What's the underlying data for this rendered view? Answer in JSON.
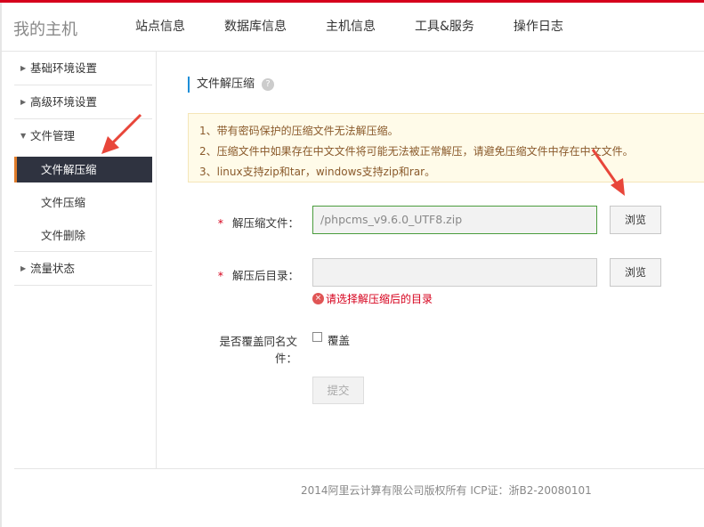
{
  "header": {
    "brand": "我的主机",
    "nav": [
      "站点信息",
      "数据库信息",
      "主机信息",
      "工具&服务",
      "操作日志"
    ]
  },
  "sidebar": {
    "basic_env": "基础环境设置",
    "advanced_env": "高级环境设置",
    "file_mgmt": "文件管理",
    "sub_items": [
      "文件解压缩",
      "文件压缩",
      "文件删除"
    ],
    "traffic": "流量状态"
  },
  "section": {
    "title": "文件解压缩",
    "help": "?"
  },
  "notice": {
    "lines": [
      "1、带有密码保护的压缩文件无法解压缩。",
      "2、压缩文件中如果存在中文文件将可能无法被正常解压，请避免压缩文件中存在中文文件。",
      "3、linux支持zip和tar，windows支持zip和rar。"
    ]
  },
  "form": {
    "required_mark": "*",
    "archive_label": "解压缩文件：",
    "archive_value": "/phpcms_v9.6.0_UTF8.zip",
    "target_label": "解压后目录：",
    "target_value": "",
    "browse": "浏览",
    "error": "请选择解压缩后的目录",
    "error_icon": "×",
    "overwrite_label": "是否覆盖同名文件：",
    "overwrite_option": "覆盖",
    "overwrite_checked": false,
    "submit": "提交"
  },
  "footer": {
    "text": "2014阿里云计算有限公司版权所有 ICP证：浙B2-20080101"
  },
  "colors": {
    "accent_red": "#d6001c",
    "active_bg": "#2f3340",
    "notice_bg": "#fffbe9",
    "title_bar": "#1c8ed8",
    "arrow": "#e8463a"
  }
}
